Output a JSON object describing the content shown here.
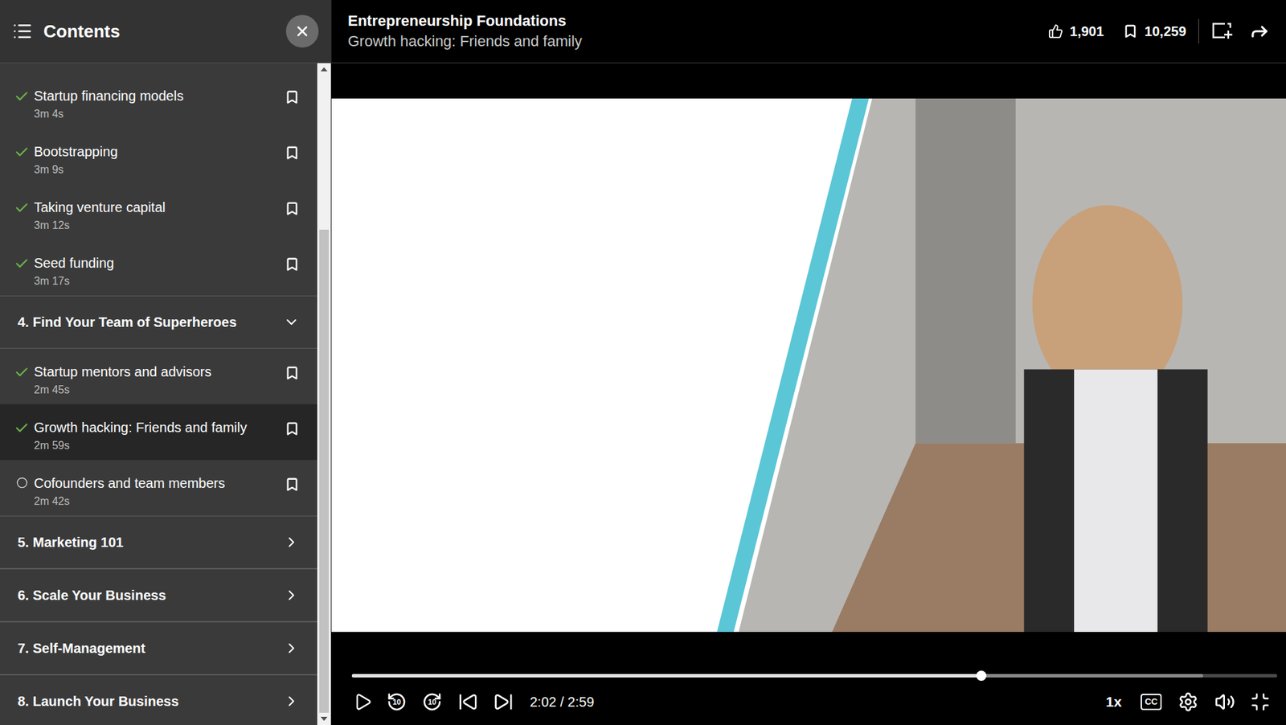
{
  "course": {
    "title": "Entrepreneurship Foundations",
    "video_title": "Growth hacking: Friends and family"
  },
  "stats": {
    "likes": "1,901",
    "saves": "10,259"
  },
  "sidebar": {
    "title": "Contents",
    "items": [
      {
        "kind": "lesson",
        "title": "Startup financing models",
        "duration": "3m 4s",
        "completed": true,
        "selected": false
      },
      {
        "kind": "lesson",
        "title": "Bootstrapping",
        "duration": "3m 9s",
        "completed": true,
        "selected": false
      },
      {
        "kind": "lesson",
        "title": "Taking venture capital",
        "duration": "3m 12s",
        "completed": true,
        "selected": false
      },
      {
        "kind": "lesson",
        "title": "Seed funding",
        "duration": "3m 17s",
        "completed": true,
        "selected": false
      },
      {
        "kind": "section",
        "title": "4. Find Your Team of Superheroes",
        "expanded": true
      },
      {
        "kind": "lesson",
        "title": "Startup mentors and advisors",
        "duration": "2m 45s",
        "completed": true,
        "selected": false
      },
      {
        "kind": "lesson",
        "title": "Growth hacking: Friends and family",
        "duration": "2m 59s",
        "completed": true,
        "selected": true
      },
      {
        "kind": "lesson",
        "title": "Cofounders and team members",
        "duration": "2m 42s",
        "completed": false,
        "selected": false
      },
      {
        "kind": "section",
        "title": "5. Marketing 101",
        "expanded": false
      },
      {
        "kind": "section",
        "title": "6. Scale Your Business",
        "expanded": false
      },
      {
        "kind": "section",
        "title": "7. Self-Management",
        "expanded": false
      },
      {
        "kind": "section",
        "title": "8. Launch Your Business",
        "expanded": false
      }
    ]
  },
  "player": {
    "playing": false,
    "time": "2:02 / 2:59",
    "level": 0.68,
    "buffered": 0.92,
    "skip_back": "10",
    "skip_forward": "10",
    "speed": "1x",
    "captions_label": "CC"
  }
}
